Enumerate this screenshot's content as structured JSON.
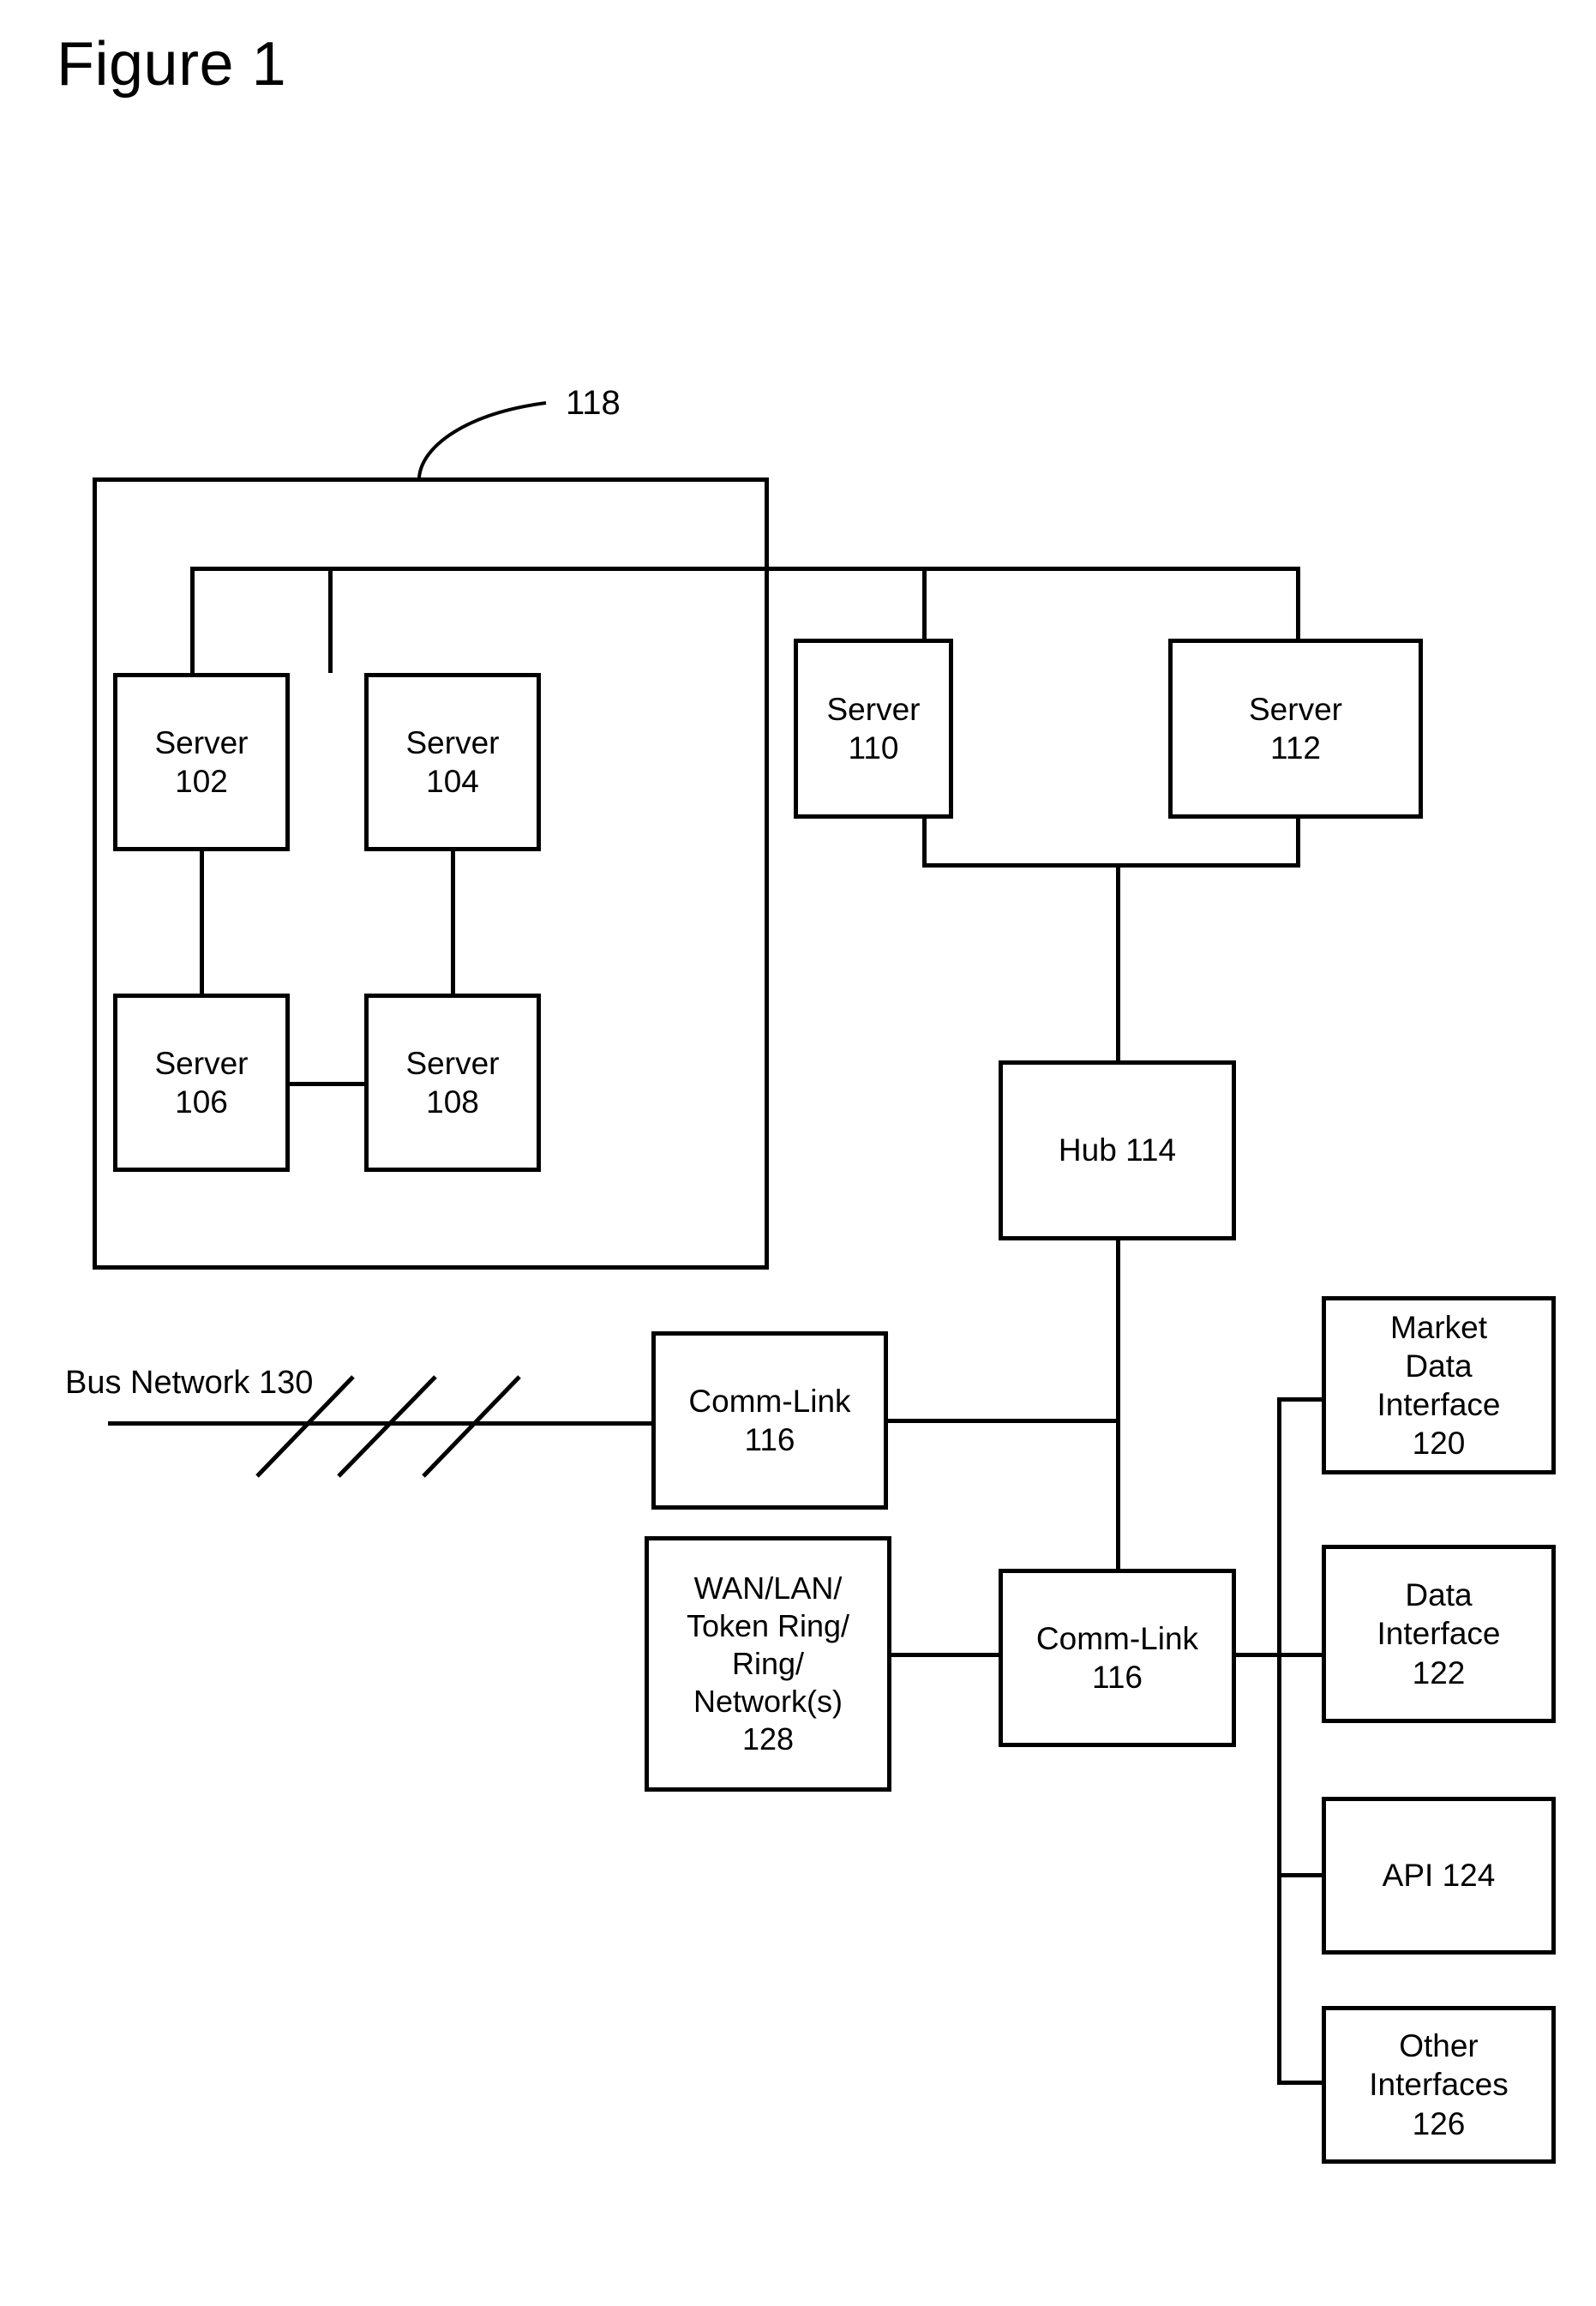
{
  "figure": {
    "title": "Figure 1"
  },
  "labels": {
    "system_ref": "118",
    "bus_network": "Bus Network 130"
  },
  "nodes": {
    "server_102": {
      "lines": [
        "Server",
        "102"
      ]
    },
    "server_104": {
      "lines": [
        "Server",
        "104"
      ]
    },
    "server_106": {
      "lines": [
        "Server",
        "106"
      ]
    },
    "server_108": {
      "lines": [
        "Server",
        "108"
      ]
    },
    "server_110": {
      "lines": [
        "Server",
        "110"
      ]
    },
    "server_112": {
      "lines": [
        "Server",
        "112"
      ]
    },
    "hub_114": {
      "lines": [
        "Hub 114"
      ]
    },
    "comm_link_116_top": {
      "lines": [
        "Comm-Link",
        "116"
      ]
    },
    "comm_link_116_bottom": {
      "lines": [
        "Comm-Link",
        "116"
      ]
    },
    "network_128": {
      "lines": [
        "WAN/LAN/",
        "Token Ring/",
        "Ring/",
        "Network(s)",
        "128"
      ]
    },
    "market_data_interface_120": {
      "lines": [
        "Market",
        "Data",
        "Interface",
        "120"
      ]
    },
    "data_interface_122": {
      "lines": [
        "Data",
        "Interface",
        "122"
      ]
    },
    "api_124": {
      "lines": [
        "API 124"
      ]
    },
    "other_interfaces_126": {
      "lines": [
        "Other",
        "Interfaces",
        "126"
      ]
    }
  },
  "colors": {
    "stroke": "#000000",
    "background": "#ffffff"
  }
}
